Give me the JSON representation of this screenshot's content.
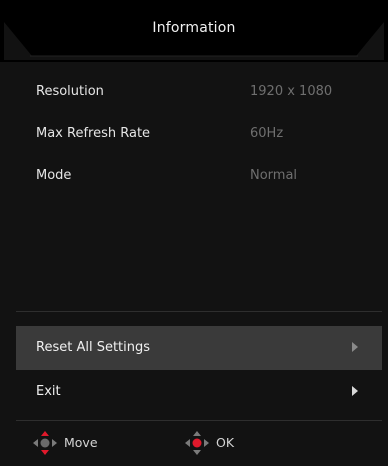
{
  "header": {
    "title": "Information"
  },
  "info": [
    {
      "label": "Resolution",
      "value": "1920 x 1080"
    },
    {
      "label": "Max Refresh Rate",
      "value": "60Hz"
    },
    {
      "label": "Mode",
      "value": "Normal"
    }
  ],
  "menu": [
    {
      "label": "Reset All Settings",
      "selected": true
    },
    {
      "label": "Exit",
      "selected": false
    }
  ],
  "footer": {
    "move_label": "Move",
    "ok_label": "OK"
  },
  "colors": {
    "accent": "#e0192b",
    "selected_bg": "#3a3a3a",
    "value_text": "#6f6f6f"
  }
}
